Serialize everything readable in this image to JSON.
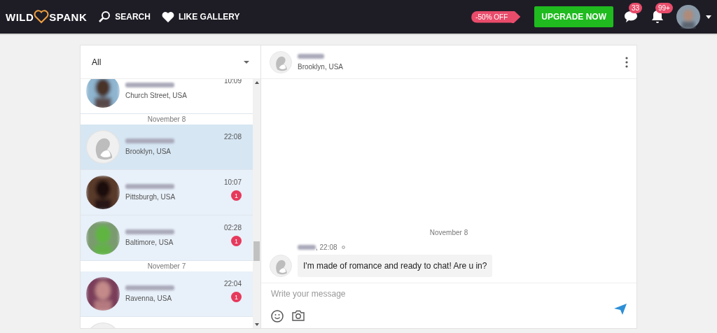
{
  "header": {
    "logo": {
      "left": "WILD",
      "right": "SPANK"
    },
    "nav": [
      {
        "kind": "search",
        "label": "SEARCH"
      },
      {
        "kind": "heart",
        "label": "LIKE GALLERY"
      }
    ],
    "discount": "-50% OFF",
    "upgrade_button": "UPGRADE NOW",
    "notifications": [
      {
        "kind": "chat",
        "count": "33"
      },
      {
        "kind": "bell",
        "count": "99+"
      }
    ]
  },
  "filter": {
    "value": "All"
  },
  "conversations": [
    {
      "kind": "conversation",
      "default_avatar": false,
      "location": "Church Street, USA",
      "time": "10:09",
      "unread": false,
      "selected": false
    },
    {
      "kind": "date",
      "label": "November 8"
    },
    {
      "kind": "conversation",
      "default_avatar": true,
      "location": "Brooklyn, USA",
      "time": "22:08",
      "selected": true
    },
    {
      "kind": "conversation",
      "default_avatar": false,
      "location": "Pittsburgh, USA",
      "time": "10:07",
      "unread": true,
      "badge": "1",
      "selected": false
    },
    {
      "kind": "conversation",
      "default_avatar": false,
      "location": "Baltimore, USA",
      "time": "02:28",
      "unread": true,
      "badge": "1",
      "selected": false
    },
    {
      "kind": "date",
      "label": "November 7"
    },
    {
      "kind": "conversation",
      "default_avatar": false,
      "location": "Ravenna, USA",
      "time": "22:04",
      "unread": true,
      "badge": "1",
      "selected": false
    },
    {
      "kind": "conversation",
      "default_avatar": true,
      "unread": false,
      "selected": false
    }
  ],
  "chat": {
    "contact": {
      "location": "Brooklyn, USA"
    },
    "messages": [
      {
        "kind": "date",
        "label": "November 8"
      },
      {
        "kind": "message",
        "time": ", 22:08",
        "text": "I'm made of romance and ready to chat! Are u in?"
      }
    ],
    "composer": {
      "placeholder": "Write your message"
    }
  }
}
